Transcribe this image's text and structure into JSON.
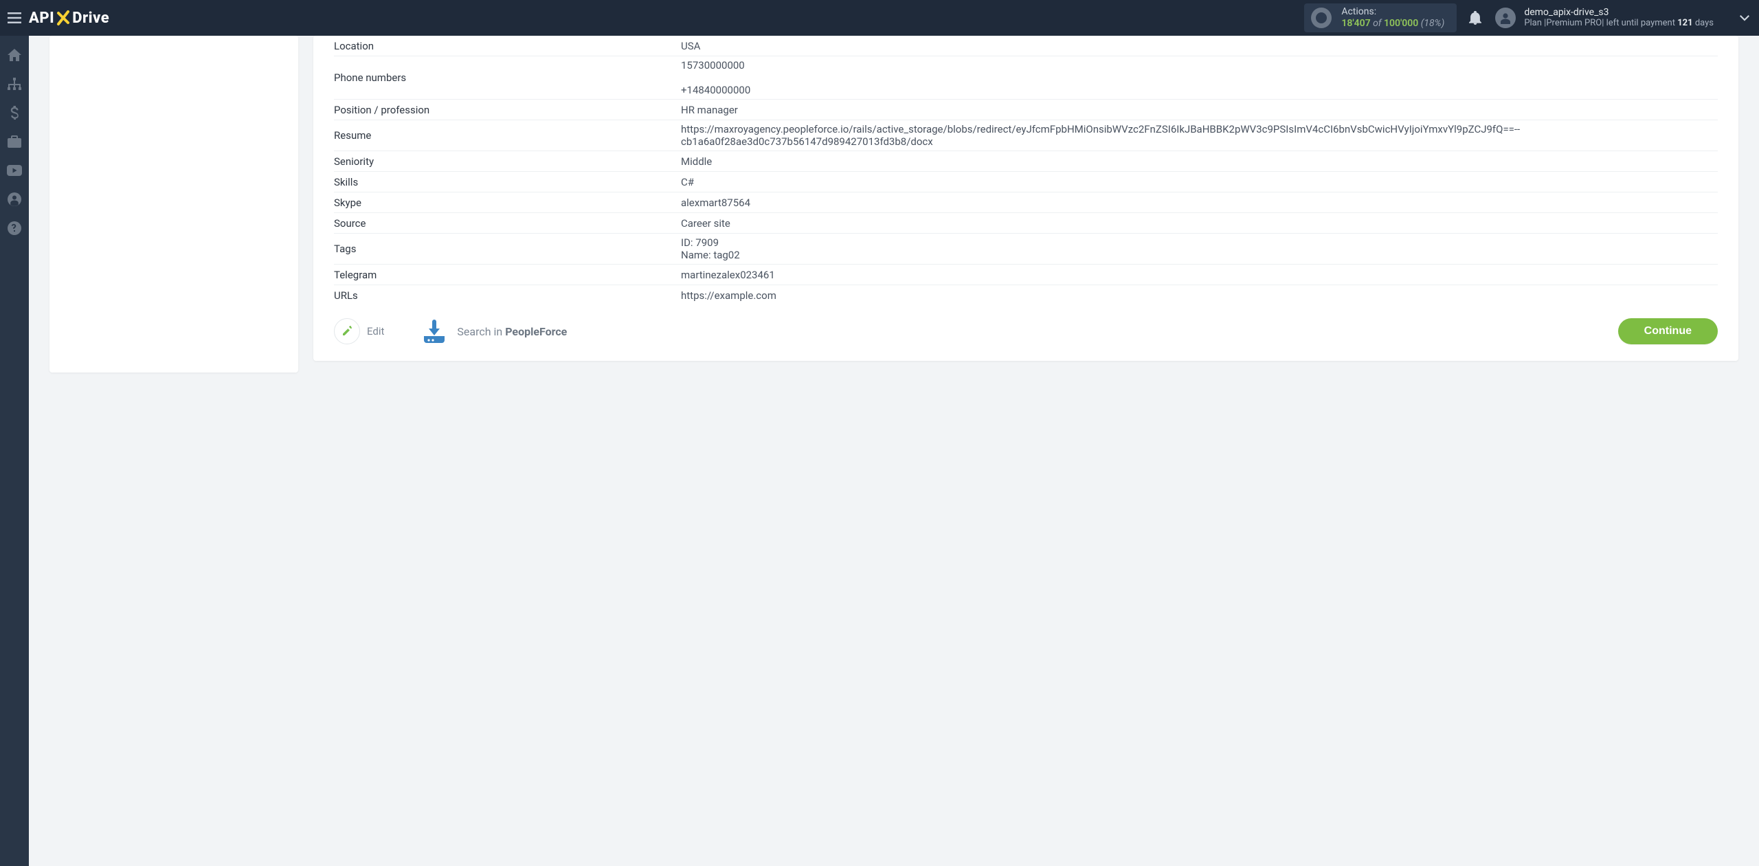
{
  "header": {
    "logo_api": "API",
    "logo_drive": "Drive",
    "actions_label": "Actions:",
    "actions_current": "18'407",
    "actions_of": " of ",
    "actions_total": "100'000",
    "actions_pct": " (18%)",
    "username": "demo_apix-drive_s3",
    "plan_prefix": "Plan |",
    "plan_name": "Premium PRO",
    "plan_mid": "| left until payment ",
    "plan_days_num": "121",
    "plan_days_suffix": " days"
  },
  "rows": [
    {
      "key": "Location",
      "val": "USA"
    },
    {
      "key": "Phone numbers",
      "val": "15730000000\n\n+14840000000"
    },
    {
      "key": "Position / profession",
      "val": "HR manager"
    },
    {
      "key": "Resume",
      "val": "https://maxroyagency.peopleforce.io/rails/active_storage/blobs/redirect/eyJfcmFpbHMiOnsibWVzc2FnZSI6IkJBaHBBK2pWV3c9PSIsImV4cCI6bnVsbCwicHVyIjoiYmxvYl9pZCJ9fQ==--cb1a6a0f28ae3d0c737b56147d989427013fd3b8/docx"
    },
    {
      "key": "Seniority",
      "val": "Middle"
    },
    {
      "key": "Skills",
      "val": "C#"
    },
    {
      "key": "Skype",
      "val": "alexmart87564"
    },
    {
      "key": "Source",
      "val": "Career site"
    },
    {
      "key": "Tags",
      "val": "ID: 7909\nName: tag02"
    },
    {
      "key": "Telegram",
      "val": "martinezalex023461"
    },
    {
      "key": "URLs",
      "val": "https://example.com"
    }
  ],
  "actions_row": {
    "edit": "Edit",
    "search_prefix": "Search in ",
    "search_target": "PeopleForce",
    "continue": "Continue"
  }
}
